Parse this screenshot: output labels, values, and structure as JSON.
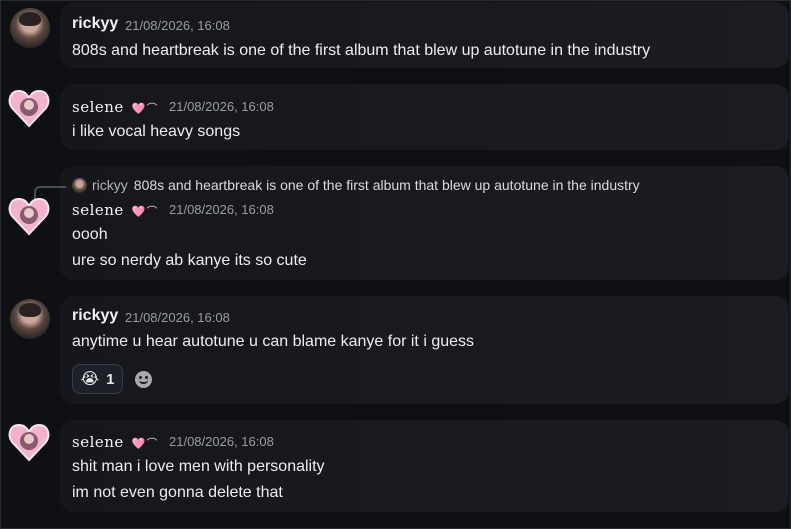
{
  "messages": [
    {
      "author": "rickyy",
      "timestamp": "21/08/2026, 16:08",
      "lines": [
        "808s and heartbreak is one of the first album that blew up autotune in the industry"
      ]
    },
    {
      "author": "selene",
      "author_deco": "🩷⌒",
      "timestamp": "21/08/2026, 16:08",
      "lines": [
        "i like vocal heavy songs"
      ]
    },
    {
      "author": "selene",
      "author_deco": "🩷⌒",
      "timestamp": "21/08/2026, 16:08",
      "reply_to": {
        "author": "rickyy",
        "text": "808s and heartbreak is one of the first album that blew up autotune in the industry"
      },
      "lines": [
        "oooh",
        "ure so nerdy ab kanye its so cute"
      ]
    },
    {
      "author": "rickyy",
      "timestamp": "21/08/2026, 16:08",
      "lines": [
        "anytime u hear autotune u can blame kanye for it i guess"
      ],
      "reaction": {
        "emoji": "😭",
        "count": "1"
      }
    },
    {
      "author": "selene",
      "author_deco": "🩷⌒",
      "timestamp": "21/08/2026, 16:08",
      "lines": [
        "shit man i love men with personality",
        "im not even gonna delete that"
      ]
    }
  ],
  "icons": {
    "rickyy_avatar": "user-avatar-icon",
    "selene_avatar": "pink-heart-avatar-icon",
    "add_reaction": "smiley-add-reaction-icon"
  },
  "colors": {
    "background": "#0f1014",
    "bubble": "#1b1d23",
    "accent_pink": "#f0c8d8"
  }
}
